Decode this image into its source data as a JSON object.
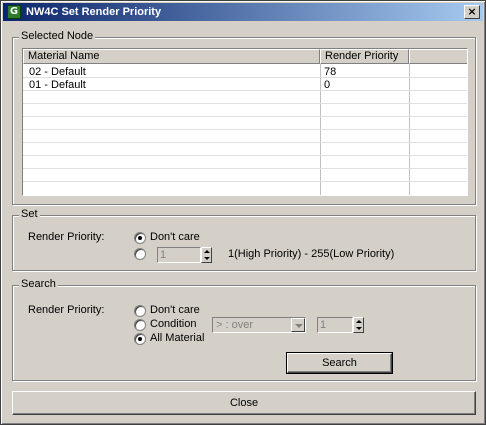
{
  "window": {
    "title": "NW4C Set Render Priority",
    "icon": "app-icon",
    "close_glyph": "×"
  },
  "selected_node": {
    "legend": "Selected Node",
    "columns": [
      "Material Name",
      "Render Priority"
    ],
    "rows": [
      {
        "material": "02 - Default",
        "priority": "78"
      },
      {
        "material": "01 - Default",
        "priority": "0"
      }
    ]
  },
  "set": {
    "legend": "Set",
    "label": "Render Priority:",
    "options": [
      "Don't care",
      ""
    ],
    "selected_index": 0,
    "spinner_value": "1",
    "range_text": "1(High Priority) - 255(Low Priority)"
  },
  "search": {
    "legend": "Search",
    "label": "Render Priority:",
    "options": [
      "Don't care",
      "Condition",
      "All Material"
    ],
    "selected_index": 2,
    "condition_value": "> : over",
    "spinner_value": "1",
    "search_button": "Search"
  },
  "footer": {
    "close_button": "Close"
  }
}
